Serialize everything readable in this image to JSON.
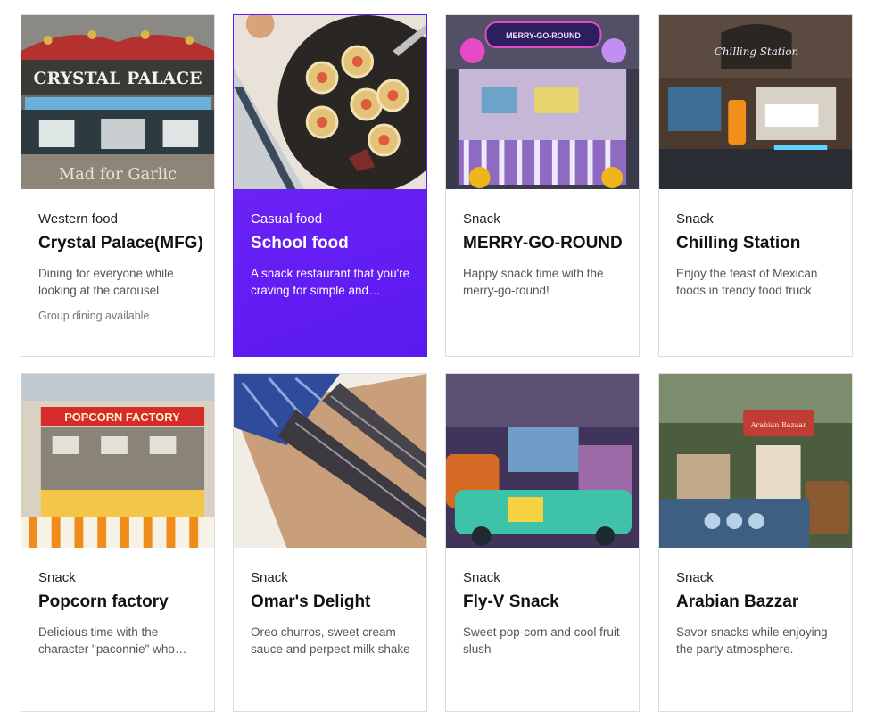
{
  "cards": [
    {
      "category": "Western food",
      "name": "Crystal Palace(MFG)",
      "description": "Dining for everyone while looking at the carousel",
      "note": "Group dining available",
      "image_signs": [
        "CRYSTAL PALACE",
        "Mad for Garlic"
      ]
    },
    {
      "category": "Casual food",
      "name": "School food",
      "description": "A snack restaurant that you're craving for simple and delicious food",
      "active_color": "#5f1cf2"
    },
    {
      "category": "Snack",
      "name": "MERRY-GO-ROUND",
      "description": "Happy snack time with the merry-go-round!",
      "image_signs": [
        "MERRY-GO-ROUND"
      ]
    },
    {
      "category": "Snack",
      "name": "Chilling Station",
      "description": "Enjoy the feast of Mexican foods in trendy food truck",
      "image_signs": [
        "Chilling Station"
      ]
    },
    {
      "category": "Snack",
      "name": "Popcorn factory",
      "description": "Delicious time with the character \"paconnie\" who loves popcorn",
      "image_signs": [
        "POPCORN FACTORY"
      ]
    },
    {
      "category": "Snack",
      "name": "Omar's Delight",
      "description": "Oreo churros, sweet cream sauce and perpect milk shake"
    },
    {
      "category": "Snack",
      "name": "Fly-V Snack",
      "description": "Sweet pop-corn and cool fruit slush"
    },
    {
      "category": "Snack",
      "name": "Arabian Bazzar",
      "description": "Savor snacks while enjoying the party atmosphere.",
      "image_signs": [
        "Arabian Bazaar"
      ]
    }
  ]
}
